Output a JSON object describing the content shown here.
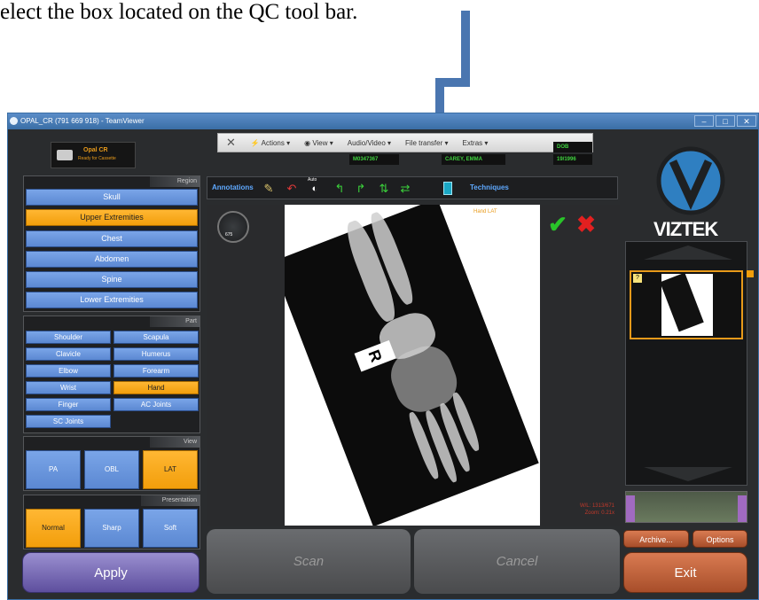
{
  "caption": "elect the box located on the QC tool bar.",
  "window_title": "OPAL_CR (791 669 918) - TeamViewer",
  "teamviewer": {
    "close": "✕",
    "actions": "⚡ Actions ▾",
    "view": "◉ View ▾",
    "audio_video": "Audio/Video ▾",
    "file_transfer": "File transfer ▾",
    "extras": "Extras ▾"
  },
  "app_status": {
    "name": "Opal CR",
    "status": "Ready for Cassette"
  },
  "patient": {
    "id": "M0347367",
    "name": "CAREY, EMMA",
    "dob_label": "DOB",
    "dob": "19/1996"
  },
  "region": {
    "header": "Region",
    "items": [
      "Skull",
      "Upper Extremities",
      "Chest",
      "Abdomen",
      "Spine",
      "Lower Extremities"
    ],
    "selected": "Upper Extremities"
  },
  "part": {
    "header": "Part",
    "items": [
      "Shoulder",
      "Scapula",
      "Clavicle",
      "Humerus",
      "Elbow",
      "Forearm",
      "Wrist",
      "Hand",
      "Finger",
      "AC Joints",
      "SC Joints"
    ],
    "selected": "Hand"
  },
  "view": {
    "header": "View",
    "items": [
      "PA",
      "OBL",
      "LAT"
    ],
    "selected": "LAT"
  },
  "presentation": {
    "header": "Presentation",
    "items": [
      "Normal",
      "Sharp",
      "Soft"
    ],
    "selected": "Normal"
  },
  "apply_label": "Apply",
  "toolbar": {
    "annotations": "Annotations",
    "techniques": "Techniques",
    "auto": "Auto"
  },
  "image": {
    "label": "Hand LAT",
    "marker": "R",
    "wl": "W/L: 1313/671",
    "zoom": "Zoom: 0.21x",
    "gauge": "675"
  },
  "scan_label": "Scan",
  "cancel_label": "Cancel",
  "brand": "VIZTEK",
  "archive_label": "Archive...",
  "options_label": "Options",
  "exit_label": "Exit",
  "colors": {
    "accent_blue": "#5b88d2",
    "selected_orange": "#f29e0b",
    "apply_purple": "#6a5bab",
    "exit_orange": "#c0633a",
    "qc_box": "#1aa7c4"
  }
}
